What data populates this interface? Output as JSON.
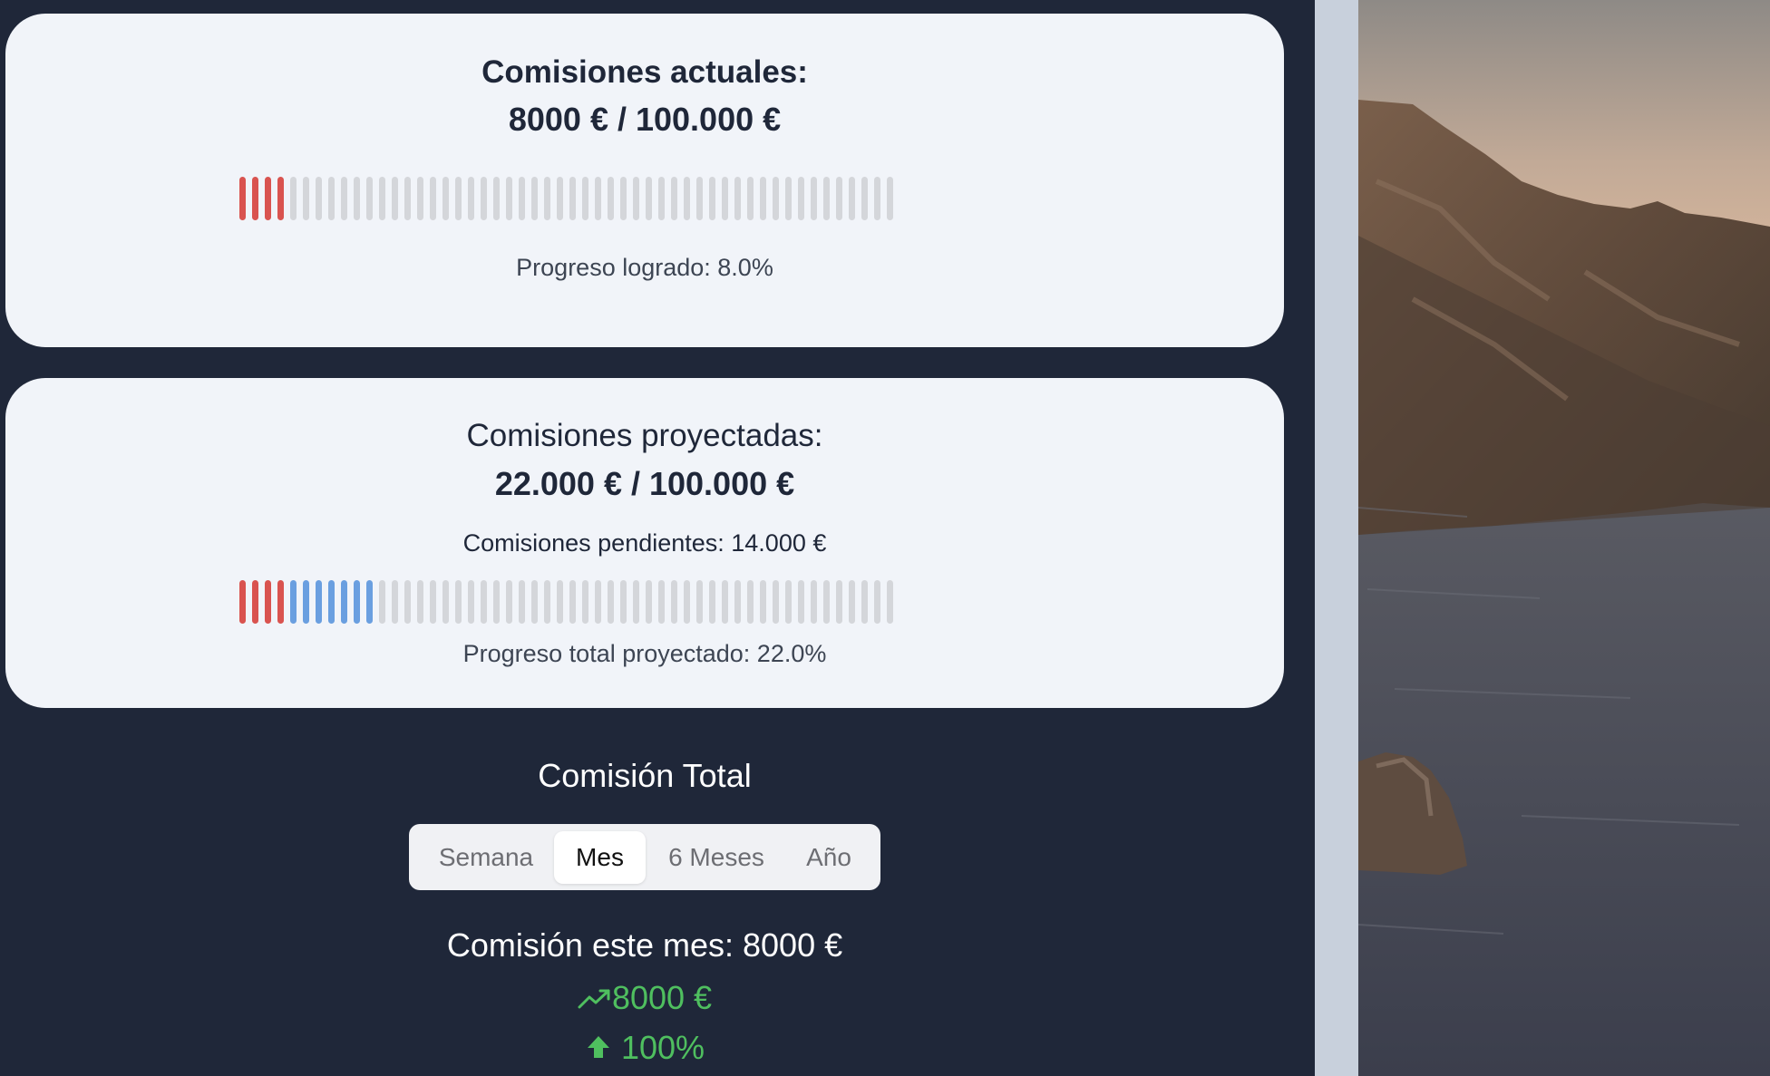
{
  "actual": {
    "title": "Comisiones actuales:",
    "amount": "8000 € / 100.000 €",
    "progress_caption": "Progreso logrado: 8.0%",
    "progress_fraction": 0.08,
    "colors": {
      "achieved": "#d9534f",
      "empty": "#d4d6da"
    }
  },
  "projected": {
    "title": "Comisiones proyectadas:",
    "amount": "22.000 € / 100.000 €",
    "pending": "Comisiones pendientes: 14.000 €",
    "progress_caption": "Progreso total proyectado: 22.0%",
    "achieved_fraction": 0.08,
    "pending_fraction": 0.14,
    "colors": {
      "achieved": "#d9534f",
      "pending": "#6a9fe0",
      "empty": "#d4d6da"
    }
  },
  "total": {
    "title": "Comisión Total",
    "tabs": [
      "Semana",
      "Mes",
      "6 Meses",
      "Año"
    ],
    "active_tab": "Mes",
    "month_line": "Comisión este mes: 8000 €",
    "trend_value": "8000 €",
    "trend_icon": "trending-up-icon",
    "percent_value": "100%",
    "percent_icon": "arrow-up-icon",
    "accent_color": "#4fbf5f"
  },
  "bar_segments": 52
}
